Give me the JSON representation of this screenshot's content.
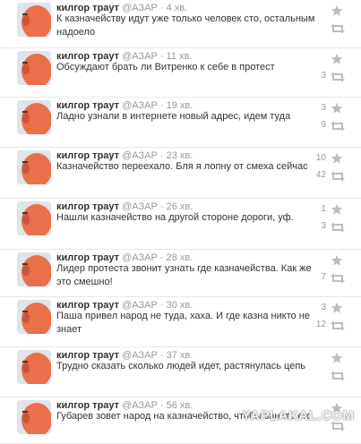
{
  "feed": {
    "tweets": [
      {
        "name": "килгор траут",
        "handle": "@АЗАР",
        "time": "4 хв.",
        "text": "К казначейству идут уже только человек сто, остальным надоело",
        "favorites": "",
        "retweets": ""
      },
      {
        "name": "килгор траут",
        "handle": "@АЗАР",
        "time": "11 хв.",
        "text": "Обсуждают брать ли Витренко к себе в протест",
        "favorites": "",
        "retweets": "3"
      },
      {
        "name": "килгор траут",
        "handle": "@АЗАР",
        "time": "19 хв.",
        "text": "Ладно узнали в интернете новый адрес, идем туда",
        "favorites": "3",
        "retweets": "9"
      },
      {
        "name": "килгор траут",
        "handle": "@АЗАР",
        "time": "23 хв.",
        "text": "Казначейство переехало. Бля я лопну от смеха сейчас",
        "favorites": "10",
        "retweets": "42"
      },
      {
        "name": "килгор траут",
        "handle": "@АЗАР",
        "time": "26 хв.",
        "text": "Нашли казначейство на другой стороне дороги, уф.",
        "favorites": "1",
        "retweets": "3"
      },
      {
        "name": "килгор траут",
        "handle": "@АЗАР",
        "time": "28 хв.",
        "text": "Лидер протеста звонит узнать где казначейства. Как же это смешно!",
        "favorites": "",
        "retweets": "7"
      },
      {
        "name": "килгор траут",
        "handle": "@АЗАР",
        "time": "30 хв.",
        "text": "Паша привел народ не туда, хаха. И где казна никто не знает",
        "favorites": "3",
        "retweets": "12"
      },
      {
        "name": "килгор траут",
        "handle": "@АЗАР",
        "time": "37 хв.",
        "text": "Трудно сказать сколько людей идет, растянулась цепь",
        "favorites": "",
        "retweets": ""
      },
      {
        "name": "килгор траут",
        "handle": "@АЗАР",
        "time": "56 хв.",
        "text": "Губарев зовет народ на казначейство, чтобы занять его",
        "favorites": "",
        "retweets": ""
      }
    ]
  },
  "separator": "·",
  "watermark": "YAPLAKAL.COM",
  "icons": {
    "favorite": "star-icon",
    "retweet": "retweet-icon",
    "avatar": "avatar-image"
  },
  "colors": {
    "name": "#333333",
    "meta": "#999999",
    "icon": "#b7bec4",
    "avatar_face": "#e9704a",
    "avatar_bg": "#dfe4e8"
  }
}
